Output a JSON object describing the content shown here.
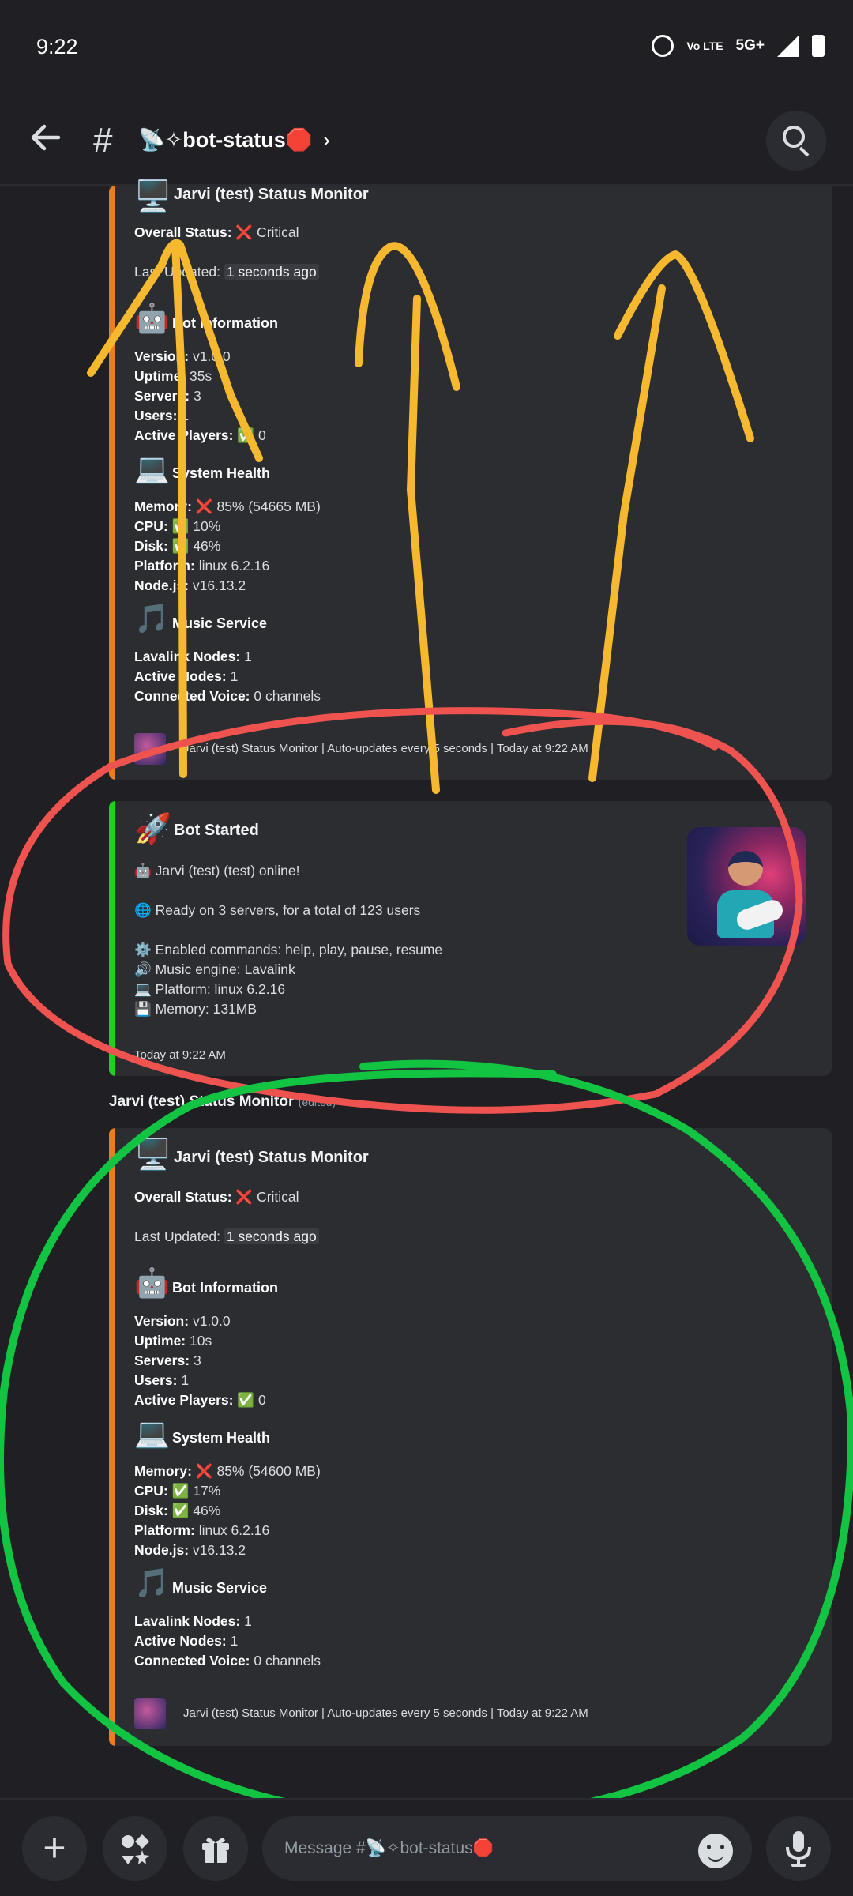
{
  "status_bar": {
    "time": "9:22",
    "network": "5G+",
    "volte": "Vo LTE",
    "icons": [
      "alarm-icon",
      "volte-icon",
      "signal-icon",
      "battery-icon"
    ]
  },
  "header": {
    "channel_name": "📡✧bot-status🛑",
    "chevron": "›",
    "icons": [
      "back-arrow-icon",
      "hash-icon",
      "search-icon"
    ]
  },
  "status_monitor_1": {
    "title": "Jarvi (test) Status Monitor",
    "overall_status_label": "Overall Status:",
    "overall_status_value": "❌ Critical",
    "last_updated_label": "Last Updated:",
    "last_updated_value": "1 seconds ago",
    "bot_info_title": "Bot Information",
    "version_label": "Version:",
    "version_value": "v1.0.0",
    "uptime_label": "Uptime:",
    "uptime_value": "35s",
    "servers_label": "Servers:",
    "servers_value": "3",
    "users_label": "Users:",
    "users_value": "1",
    "active_players_label": "Active Players:",
    "active_players_value": "✅ 0",
    "system_health_title": "System Health",
    "memory_label": "Memory:",
    "memory_value": "❌ 85% (54665 MB)",
    "cpu_label": "CPU:",
    "cpu_value": "✅ 10%",
    "disk_label": "Disk:",
    "disk_value": "✅ 46%",
    "platform_label": "Platform:",
    "platform_value": "linux 6.2.16",
    "node_label": "Node.js:",
    "node_value": "v16.13.2",
    "music_title": "Music Service",
    "lavalink_label": "Lavalink Nodes:",
    "lavalink_value": "1",
    "active_nodes_label": "Active Nodes:",
    "active_nodes_value": "1",
    "voice_label": "Connected Voice:",
    "voice_value": "0 channels",
    "footer": "Jarvi (test) Status Monitor | Auto-updates every 5 seconds | Today at 9:22 AM"
  },
  "bot_started": {
    "title": "Bot Started",
    "online": "Jarvi (test) (test) online!",
    "ready": "Ready on 3 servers, for a total of 123 users",
    "commands": "Enabled commands: help, play, pause, resume",
    "music_engine": "Music engine: Lavalink",
    "platform": "Platform: linux 6.2.16",
    "memory": "Memory: 131MB",
    "timestamp": "Today at 9:22 AM"
  },
  "author": {
    "name": "Jarvi (test) Status Monitor",
    "edited": "(edited)"
  },
  "status_monitor_2": {
    "title": "Jarvi (test) Status Monitor",
    "overall_status_label": "Overall Status:",
    "overall_status_value": "❌ Critical",
    "last_updated_label": "Last Updated:",
    "last_updated_value": "1 seconds ago",
    "bot_info_title": "Bot Information",
    "version_label": "Version:",
    "version_value": "v1.0.0",
    "uptime_label": "Uptime:",
    "uptime_value": "10s",
    "servers_label": "Servers:",
    "servers_value": "3",
    "users_label": "Users:",
    "users_value": "1",
    "active_players_label": "Active Players:",
    "active_players_value": "✅ 0",
    "system_health_title": "System Health",
    "memory_label": "Memory:",
    "memory_value": "❌ 85% (54600 MB)",
    "cpu_label": "CPU:",
    "cpu_value": "✅ 17%",
    "disk_label": "Disk:",
    "disk_value": "✅ 46%",
    "platform_label": "Platform:",
    "platform_value": "linux 6.2.16",
    "node_label": "Node.js:",
    "node_value": "v16.13.2",
    "music_title": "Music Service",
    "lavalink_label": "Lavalink Nodes:",
    "lavalink_value": "1",
    "active_nodes_label": "Active Nodes:",
    "active_nodes_value": "1",
    "voice_label": "Connected Voice:",
    "voice_value": "0 channels",
    "footer": "Jarvi (test) Status Monitor | Auto-updates every 5 seconds | Today at 9:22 AM"
  },
  "composer": {
    "placeholder": "Message #📡✧bot-status🛑",
    "icons": [
      "plus-icon",
      "apps-icon",
      "gift-icon",
      "emoji-icon",
      "microphone-icon"
    ]
  },
  "colors": {
    "background": "#1f1f24",
    "embed": "#2b2d31",
    "embed_border_orange": "#e67e22",
    "embed_border_green": "#1fd11f",
    "annotation_yellow": "#f5b82e",
    "annotation_red": "#ef5350",
    "annotation_green": "#12c442"
  }
}
